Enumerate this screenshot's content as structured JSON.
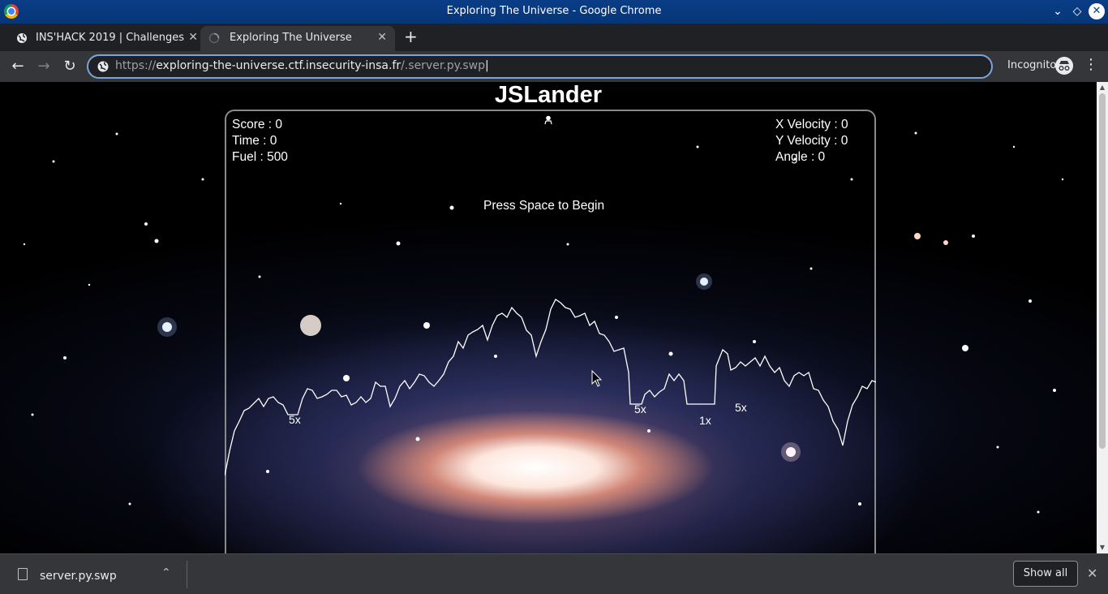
{
  "window": {
    "title": "Exploring The Universe - Google Chrome"
  },
  "tabs": [
    {
      "label": "INS'HACK 2019 | Challenges",
      "active": false
    },
    {
      "label": "Exploring The Universe",
      "active": true
    }
  ],
  "toolbar": {
    "url_scheme": "https://",
    "url_host": "exploring-the-universe.ctf.insecurity-insa.fr",
    "url_path": "/.server.py.swp",
    "incognito_label": "Incognito"
  },
  "game": {
    "title": "JSLander",
    "hud_left": {
      "score": "Score : 0",
      "time": "Time : 0",
      "fuel": "Fuel : 500"
    },
    "hud_right": {
      "x_velocity": "X Velocity : 0",
      "y_velocity": "Y Velocity : 0",
      "angle": "Angle : 0"
    },
    "prompt": "Press Space to Begin",
    "multipliers": [
      "5x",
      "5x",
      "1x",
      "5x"
    ]
  },
  "downloads": {
    "file_name": "server.py.swp",
    "show_all_label": "Show all"
  },
  "colors": {
    "titlebar": "#0a3d86",
    "tabstrip": "#202124",
    "toolbar": "#35363a",
    "omnibox_focus": "#7ea3d6"
  }
}
